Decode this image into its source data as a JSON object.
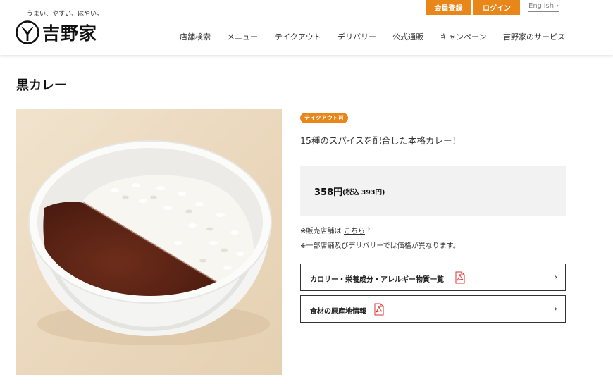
{
  "header": {
    "tagline": "うまい、やすい、はやい。",
    "logo_text": "吉野家",
    "register_label": "会員登録",
    "login_label": "ログイン",
    "english_label": "English ›",
    "nav": [
      "店舗検索",
      "メニュー",
      "テイクアウト",
      "デリバリー",
      "公式通販",
      "キャンペーン",
      "吉野家のサービス"
    ]
  },
  "page": {
    "title": "黒カレー"
  },
  "product": {
    "badge": "テイクアウト可",
    "description": "15種のスパイスを配合した本格カレー！",
    "price": "358円",
    "price_tax": "(税込 393円)",
    "store_note_prefix": "※販売店舗は",
    "store_note_link": "こちら",
    "delivery_note": "※一部店舗及びデリバリーでは価格が異なります。",
    "links": [
      {
        "label": "カロリー・栄養成分・アレルギー物質一覧",
        "icon": "pdf-icon"
      },
      {
        "label": "食材の原産地情報",
        "icon": "pdf-icon"
      }
    ]
  },
  "colors": {
    "accent": "#e8861a",
    "price_bg": "#f2f2f2",
    "text": "#222222"
  }
}
